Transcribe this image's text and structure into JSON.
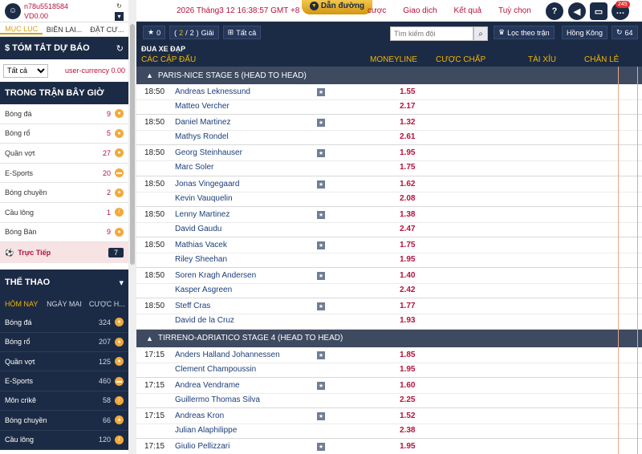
{
  "user": {
    "name": "n78u5518584",
    "balance": "VD0.00"
  },
  "side_tabs": [
    "MỤC LỤC",
    "BIÊN LAI...",
    "ĐẶT CƯ..."
  ],
  "summary": {
    "title": "$ TÓM TẮT DỰ BÁO",
    "filter": "Tất cả",
    "currency": "user-currency 0.00"
  },
  "live": {
    "title": "TRONG TRẬN BÂY GIỜ",
    "items": [
      {
        "label": "Bóng đá",
        "count": "9"
      },
      {
        "label": "Bóng rổ",
        "count": "5"
      },
      {
        "label": "Quần vợt",
        "count": "27"
      },
      {
        "label": "E-Sports",
        "count": "20"
      },
      {
        "label": "Bóng chuyền",
        "count": "2"
      },
      {
        "label": "Cầu lông",
        "count": "1"
      },
      {
        "label": "Bóng Bàn",
        "count": "9"
      }
    ],
    "live_label": "Trực Tiếp",
    "live_count": "7"
  },
  "sports": {
    "title": "THỂ THAO",
    "tabs": [
      "HÔM NAY",
      "NGÀY MAI",
      "CƯỢC H..."
    ],
    "items": [
      {
        "label": "Bóng đá",
        "count": "324"
      },
      {
        "label": "Bóng rổ",
        "count": "207"
      },
      {
        "label": "Quần vợt",
        "count": "125"
      },
      {
        "label": "E-Sports",
        "count": "460"
      },
      {
        "label": "Môn crikê",
        "count": "58"
      },
      {
        "label": "Bóng chuyền",
        "count": "66"
      },
      {
        "label": "Cầu lông",
        "count": "120"
      }
    ]
  },
  "header": {
    "clock": "2026 Tháng3 12 16:38:57 GMT +8",
    "guide": "Dẫn đường",
    "nav": [
      "cược",
      "Giao dịch",
      "Kết quả",
      "Tuỳ chọn"
    ],
    "notif_count": "245"
  },
  "toolbar": {
    "star_count": "0",
    "page_current": "2",
    "page_total": "2",
    "page_label": "Giải",
    "all_label": "Tất cả",
    "search_placeholder": "Tìm kiếm đội",
    "filter_label": "Lọc theo trận",
    "odds_format": "Hồng Kông",
    "refresh_count": "64"
  },
  "event": {
    "sport": "ĐUA XE ĐẠP",
    "type": "CÁC CẶP ĐẤU",
    "columns": [
      "MONEYLINE",
      "CƯỢC CHẤP",
      "TÀI XỈU",
      "CHẴN LẺ"
    ]
  },
  "leagues": [
    {
      "name": "PARIS-NICE STAGE 5 (HEAD TO HEAD)",
      "matches": [
        {
          "time": "18:50",
          "p1": "Andreas Leknessund",
          "p2": "Matteo Vercher",
          "o1": "1.55",
          "o2": "2.17"
        },
        {
          "time": "18:50",
          "p1": "Daniel Martinez",
          "p2": "Mathys Rondel",
          "o1": "1.32",
          "o2": "2.61"
        },
        {
          "time": "18:50",
          "p1": "Georg Steinhauser",
          "p2": "Marc Soler",
          "o1": "1.95",
          "o2": "1.75"
        },
        {
          "time": "18:50",
          "p1": "Jonas Vingegaard",
          "p2": "Kevin Vauquelin",
          "o1": "1.62",
          "o2": "2.08"
        },
        {
          "time": "18:50",
          "p1": "Lenny Martinez",
          "p2": "David Gaudu",
          "o1": "1.38",
          "o2": "2.47"
        },
        {
          "time": "18:50",
          "p1": "Mathias Vacek",
          "p2": "Riley Sheehan",
          "o1": "1.75",
          "o2": "1.95"
        },
        {
          "time": "18:50",
          "p1": "Soren Kragh Andersen",
          "p2": "Kasper Asgreen",
          "o1": "1.40",
          "o2": "2.42"
        },
        {
          "time": "18:50",
          "p1": "Steff Cras",
          "p2": "David de la Cruz",
          "o1": "1.77",
          "o2": "1.93"
        }
      ]
    },
    {
      "name": "TIRRENO-ADRIATICO STAGE 4 (HEAD TO HEAD)",
      "matches": [
        {
          "time": "17:15",
          "p1": "Anders Halland Johannessen",
          "p2": "Clement Champoussin",
          "o1": "1.85",
          "o2": "1.95"
        },
        {
          "time": "17:15",
          "p1": "Andrea Vendrame",
          "p2": "Guillermo Thomas Silva",
          "o1": "1.60",
          "o2": "2.25"
        },
        {
          "time": "17:15",
          "p1": "Andreas Kron",
          "p2": "Julian Alaphilippe",
          "o1": "1.52",
          "o2": "2.38"
        },
        {
          "time": "17:15",
          "p1": "Giulio Pellizzari",
          "p2": "",
          "o1": "1.95",
          "o2": ""
        }
      ]
    }
  ]
}
